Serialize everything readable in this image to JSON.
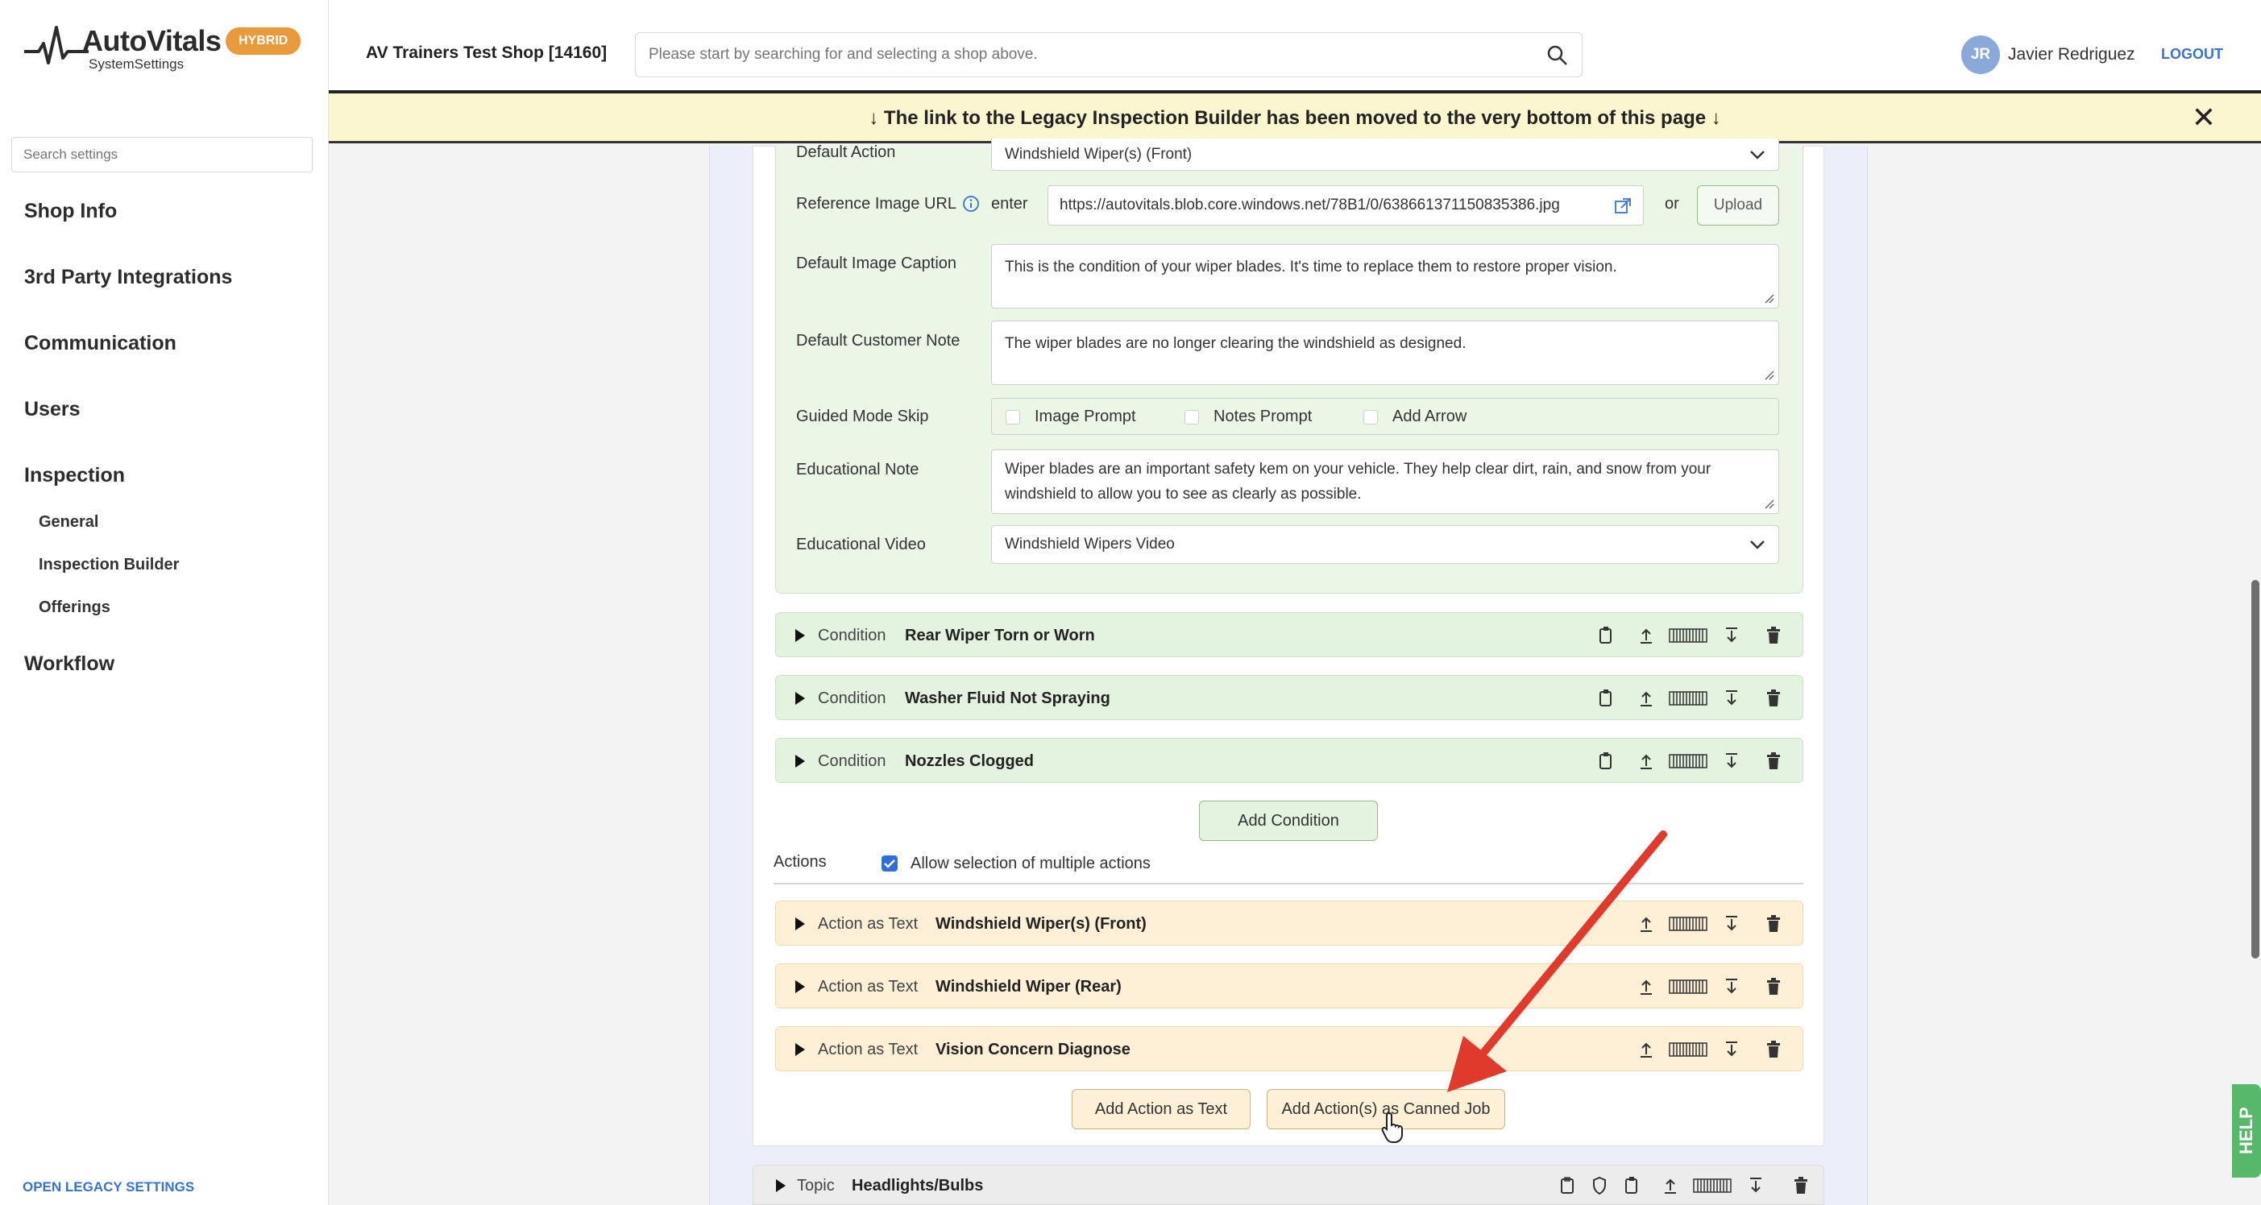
{
  "sidebar": {
    "logo_text": "AutoVitals",
    "logo_sub": "SystemSettings",
    "badge": "HYBRID",
    "search_placeholder": "Search settings",
    "items": [
      "Shop Info",
      "3rd Party Integrations",
      "Communication",
      "Users",
      "Inspection",
      "Workflow"
    ],
    "inspection_sub": [
      "General",
      "Inspection Builder",
      "Offerings"
    ],
    "legacy_link": "OPEN LEGACY SETTINGS"
  },
  "header": {
    "shop_name": "AV Trainers Test Shop [14160]",
    "search_placeholder": "Please start by searching for and selecting a shop above.",
    "avatar_initials": "JR",
    "user_name": "Javier Redriguez",
    "logout": "LOGOUT"
  },
  "banner": {
    "text": "↓  The link to the Legacy Inspection Builder has been moved to the very bottom of this page  ↓",
    "close": "✕"
  },
  "form": {
    "default_action_label": "Default Action",
    "default_action_value": "Windshield Wiper(s) (Front)",
    "ref_image_label": "Reference Image URL",
    "ref_enter": "enter",
    "ref_url": "https://autovitals.blob.core.windows.net/78B1/0/638661371150835386.jpg",
    "ref_or": "or",
    "upload": "Upload",
    "caption_label": "Default Image Caption",
    "caption_value": "This is the condition of your wiper blades. It's time to replace them to restore proper vision.",
    "note_label": "Default Customer Note",
    "note_value": "The wiper blades are no longer clearing the windshield as designed.",
    "guided_label": "Guided Mode Skip",
    "guided_options": [
      "Image Prompt",
      "Notes Prompt",
      "Add Arrow"
    ],
    "edu_note_label": "Educational Note",
    "edu_note_value": "Wiper blades are an important safety kem on your vehicle. They help clear dirt, rain, and snow from your windshield to allow you to see as clearly as possible.",
    "edu_video_label": "Educational Video",
    "edu_video_value": "Windshield Wipers Video"
  },
  "conditions": [
    {
      "type": "Condition",
      "name": "Rear Wiper Torn or Worn"
    },
    {
      "type": "Condition",
      "name": "Washer Fluid Not Spraying"
    },
    {
      "type": "Condition",
      "name": "Nozzles Clogged"
    }
  ],
  "add_condition": "Add Condition",
  "actions_section": {
    "label": "Actions",
    "allow_multiple": "Allow selection of multiple actions"
  },
  "actions": [
    {
      "type": "Action as Text",
      "name": "Windshield Wiper(s) (Front)"
    },
    {
      "type": "Action as Text",
      "name": "Windshield Wiper (Rear)"
    },
    {
      "type": "Action as Text",
      "name": "Vision Concern Diagnose"
    }
  ],
  "add_action_text": "Add Action as Text",
  "add_action_canned": "Add Action(s) as Canned Job",
  "topic": {
    "type": "Topic",
    "name": "Headlights/Bulbs"
  },
  "help": "HELP",
  "colors": {
    "accent": "#3a74c9",
    "badge": "#e89b3d",
    "condition_bg": "#e3f3df",
    "action_bg": "#fdf0d6",
    "arrow": "#e03a2c"
  }
}
